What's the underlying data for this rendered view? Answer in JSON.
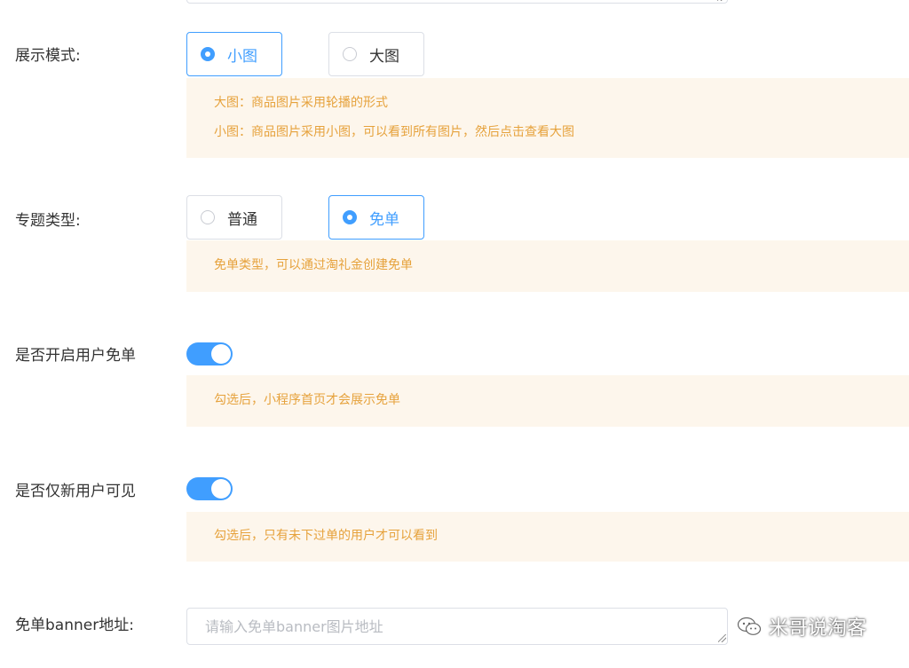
{
  "display_mode": {
    "label": "展示模式:",
    "options": [
      {
        "label": "小图",
        "checked": true
      },
      {
        "label": "大图",
        "checked": false
      }
    ],
    "tips": [
      "大图：商品图片采用轮播的形式",
      "小图：商品图片采用小图，可以看到所有图片，然后点击查看大图"
    ]
  },
  "topic_type": {
    "label": "专题类型:",
    "options": [
      {
        "label": "普通",
        "checked": false
      },
      {
        "label": "免单",
        "checked": true
      }
    ],
    "tip": "免单类型，可以通过淘礼金创建免单"
  },
  "enable_free_order": {
    "label": "是否开启用户免单",
    "on": true,
    "tip": "勾选后，小程序首页才会展示免单"
  },
  "new_user_only": {
    "label": "是否仅新用户可见",
    "on": true,
    "tip": "勾选后，只有未下过单的用户才可以看到"
  },
  "banner_url": {
    "label": "免单banner地址:",
    "value": "",
    "placeholder": "请输入免单banner图片地址"
  },
  "watermark": {
    "text": "米哥说淘客",
    "icon": "wechat-icon"
  },
  "colors": {
    "primary": "#409eff",
    "tip_bg": "#fdf6ec",
    "tip_text": "#e6a23c",
    "border": "#dcdfe6"
  }
}
